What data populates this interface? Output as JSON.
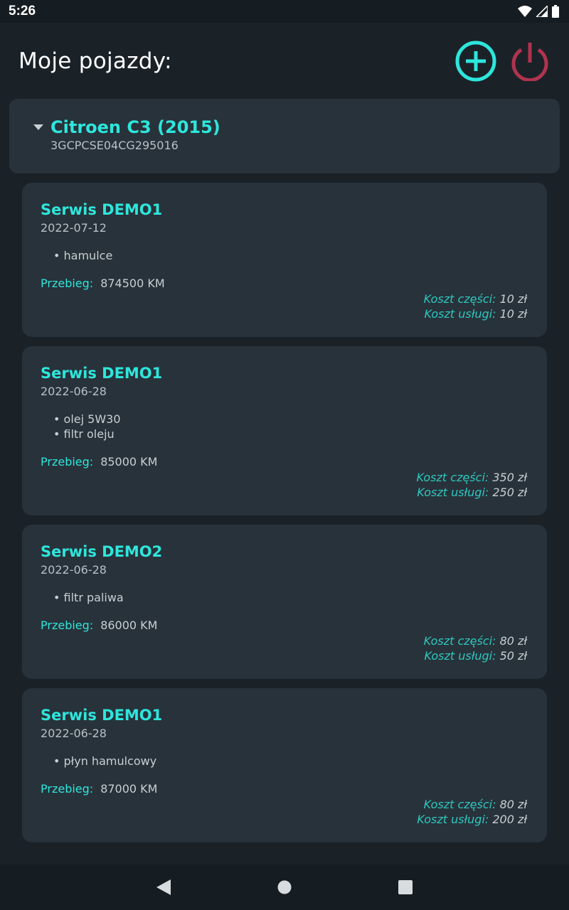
{
  "status_bar": {
    "time": "5:26",
    "icons": [
      "wifi-icon",
      "signal-icon",
      "battery-icon"
    ]
  },
  "header": {
    "title": "Moje pojazdy:",
    "add_icon": "add-circle-icon",
    "power_icon": "power-icon"
  },
  "colors": {
    "accent": "#2ee6dc",
    "power": "#b0334f",
    "card": "#28323a",
    "background": "#1a2228"
  },
  "vehicle": {
    "name": "Citroen C3 (2015)",
    "vin": "3GCPCSE04CG295016",
    "expand_icon": "caret-down-icon"
  },
  "services": [
    {
      "name": "Serwis DEMO1",
      "date": "2022-07-12",
      "items": [
        "• hamulce"
      ],
      "mileage_label": "Przebieg:",
      "mileage_value": "874500 KM",
      "parts_cost_label": "Koszt części:",
      "parts_cost_value": "10 zł",
      "service_cost_label": "Koszt usługi:",
      "service_cost_value": "10 zł"
    },
    {
      "name": "Serwis DEMO1",
      "date": "2022-06-28",
      "items": [
        "• olej 5W30",
        "• filtr oleju"
      ],
      "mileage_label": "Przebieg:",
      "mileage_value": "85000 KM",
      "parts_cost_label": "Koszt części:",
      "parts_cost_value": "350 zł",
      "service_cost_label": "Koszt usługi:",
      "service_cost_value": "250 zł"
    },
    {
      "name": "Serwis DEMO2",
      "date": "2022-06-28",
      "items": [
        "• filtr paliwa"
      ],
      "mileage_label": "Przebieg:",
      "mileage_value": "86000 KM",
      "parts_cost_label": "Koszt części:",
      "parts_cost_value": "80 zł",
      "service_cost_label": "Koszt usługi:",
      "service_cost_value": "50 zł"
    },
    {
      "name": "Serwis DEMO1",
      "date": "2022-06-28",
      "items": [
        "• płyn hamulcowy"
      ],
      "mileage_label": "Przebieg:",
      "mileage_value": "87000 KM",
      "parts_cost_label": "Koszt części:",
      "parts_cost_value": "80 zł",
      "service_cost_label": "Koszt usługi:",
      "service_cost_value": "200 zł"
    }
  ],
  "nav_bar": {
    "back_icon": "back-triangle-icon",
    "home_icon": "home-circle-icon",
    "recents_icon": "recents-square-icon"
  }
}
